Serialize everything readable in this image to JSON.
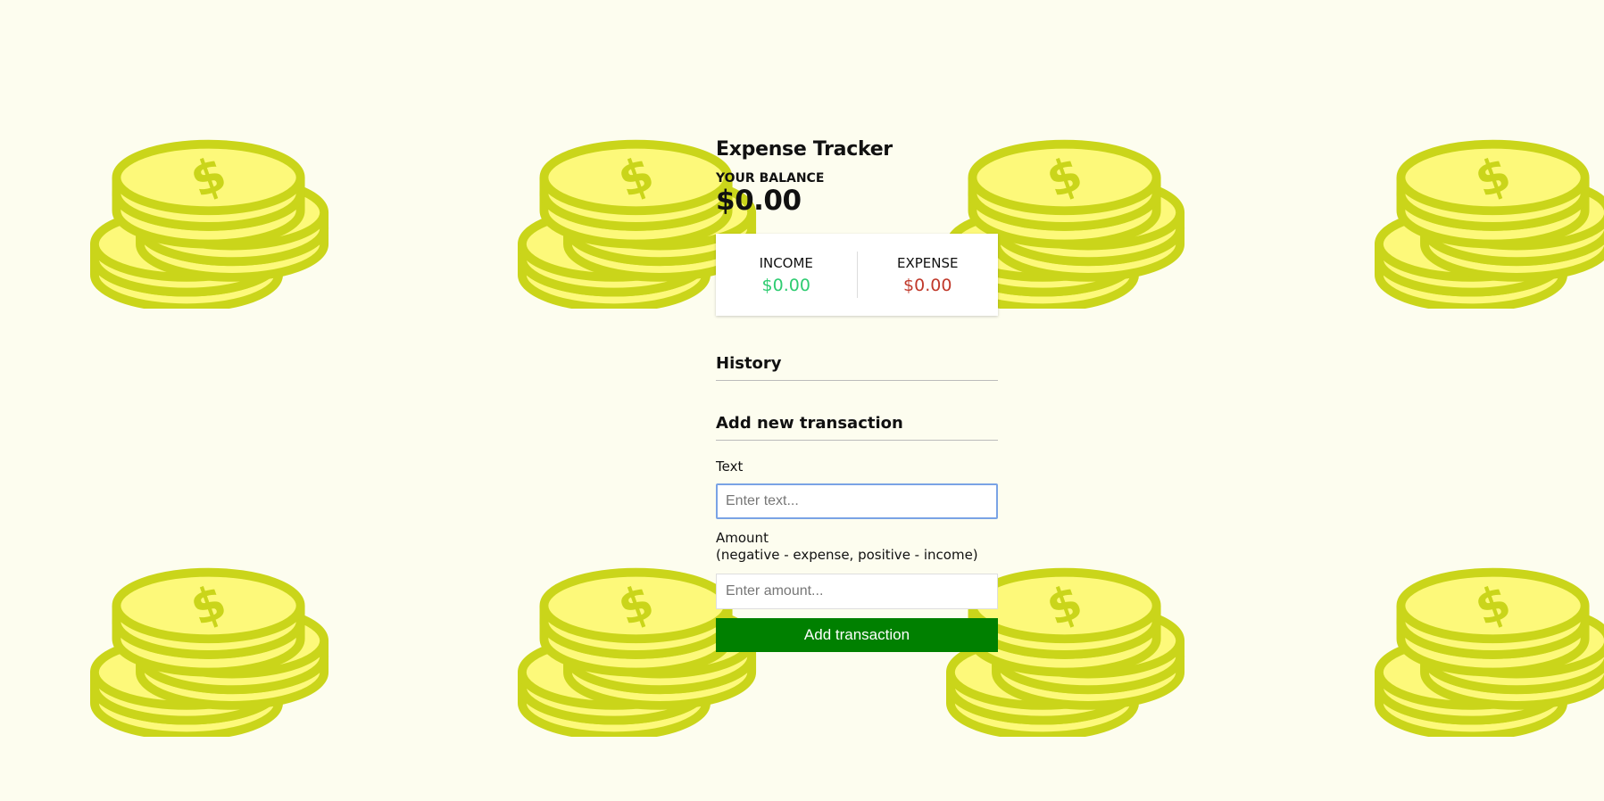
{
  "app": {
    "title": "Expense Tracker"
  },
  "balance": {
    "label": "YOUR BALANCE",
    "amount": "$0.00"
  },
  "summary": {
    "income_label": "INCOME",
    "income_amount": "$0.00",
    "expense_label": "EXPENSE",
    "expense_amount": "$0.00"
  },
  "history": {
    "heading": "History"
  },
  "form": {
    "heading": "Add new transaction",
    "text_label": "Text",
    "text_placeholder": "Enter text...",
    "amount_label": "Amount",
    "amount_hint": "(negative - expense, positive - income)",
    "amount_placeholder": "Enter amount...",
    "submit_label": "Add transaction"
  },
  "background": {
    "icon": "coin-stack-icon",
    "coin_fill": "#fdf97a",
    "coin_stroke": "#cad51a"
  },
  "colors": {
    "income": "#2ecc71",
    "expense": "#c0392b",
    "button": "#008000"
  }
}
